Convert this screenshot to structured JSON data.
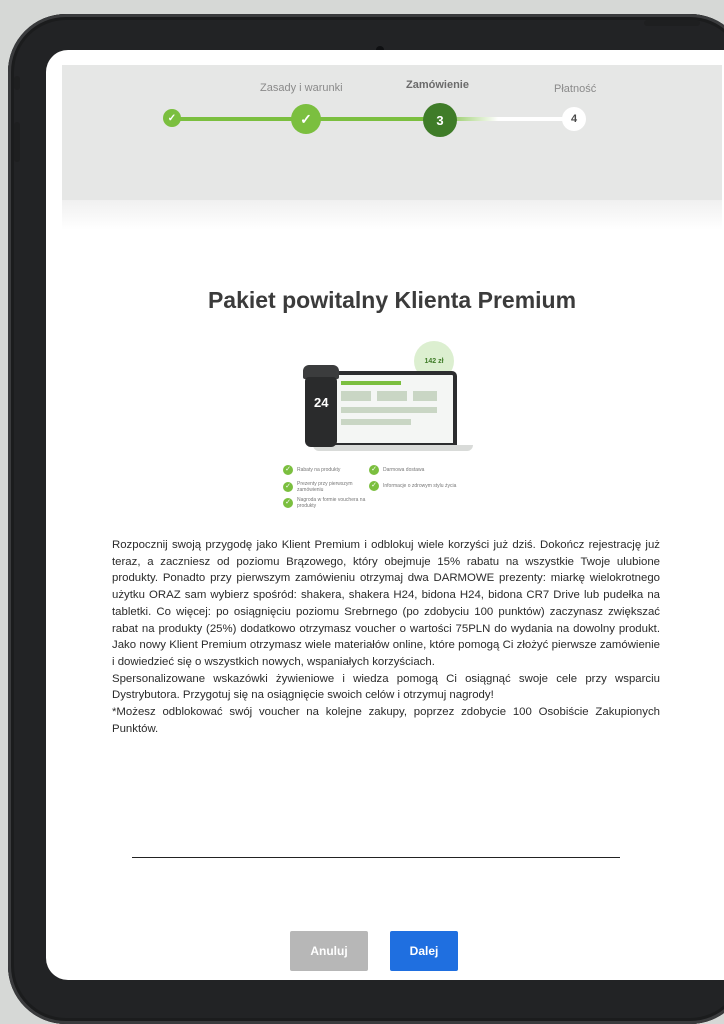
{
  "stepper": {
    "steps": [
      {
        "label": "",
        "state": "done",
        "marker": "✓"
      },
      {
        "label": "Zasady i warunki",
        "state": "done",
        "marker": "✓"
      },
      {
        "label": "Zamówienie",
        "state": "current",
        "marker": "3"
      },
      {
        "label": "Płatność",
        "state": "upcoming",
        "marker": "4"
      }
    ]
  },
  "title": "Pakiet powitalny Klienta Premium",
  "promo": {
    "price": "142 zł",
    "shaker_logo": "24",
    "benefits": [
      "Rabaty na produkty",
      "Darmowa dostawa",
      "Prezenty przy pierwszym zamówieniu",
      "Informacje o zdrowym stylu życia",
      "Nagroda w formie vouchera na produkty"
    ]
  },
  "description": {
    "paragraph1": "Rozpocznij swoją przygodę jako Klient Premium i odblokuj wiele korzyści już dziś. Dokończ rejestrację już teraz, a zaczniesz od poziomu Brązowego, który obejmuje 15% rabatu na wszystkie Twoje ulubione produkty. Ponadto przy pierwszym zamówieniu otrzymaj dwa DARMOWE prezenty: miarkę wielokrotnego użytku ORAZ sam wybierz spośród: shakera, shakera H24, bidona H24, bidona CR7 Drive lub pudełka na tabletki. Co więcej: po osiągnięciu poziomu Srebrnego (po zdobyciu 100 punktów) zaczynasz zwiększać rabat na produkty (25%) dodatkowo otrzymasz voucher o wartości 75PLN do wydania na dowolny produkt. Jako nowy Klient Premium otrzymasz wiele materiałów online, które pomogą Ci złożyć pierwsze zamówienie i dowiedzieć się o wszystkich nowych, wspaniałych korzyściach.",
    "paragraph2": "Spersonalizowane wskazówki żywieniowe i wiedza pomogą Ci osiągnąć swoje cele przy wsparciu Dystrybutora. Przygotuj się na osiągnięcie swoich celów i otrzymuj nagrody!",
    "paragraph3": "*Możesz odblokować swój voucher na kolejne zakupy, poprzez zdobycie 100 Osobiście Zakupionych Punktów."
  },
  "buttons": {
    "cancel": "Anuluj",
    "next": "Dalej"
  },
  "colors": {
    "accent_green": "#7bbf3f",
    "current_step": "#3f7c28",
    "primary_button": "#1f6fe0",
    "disabled_button": "#b7b7b7"
  }
}
